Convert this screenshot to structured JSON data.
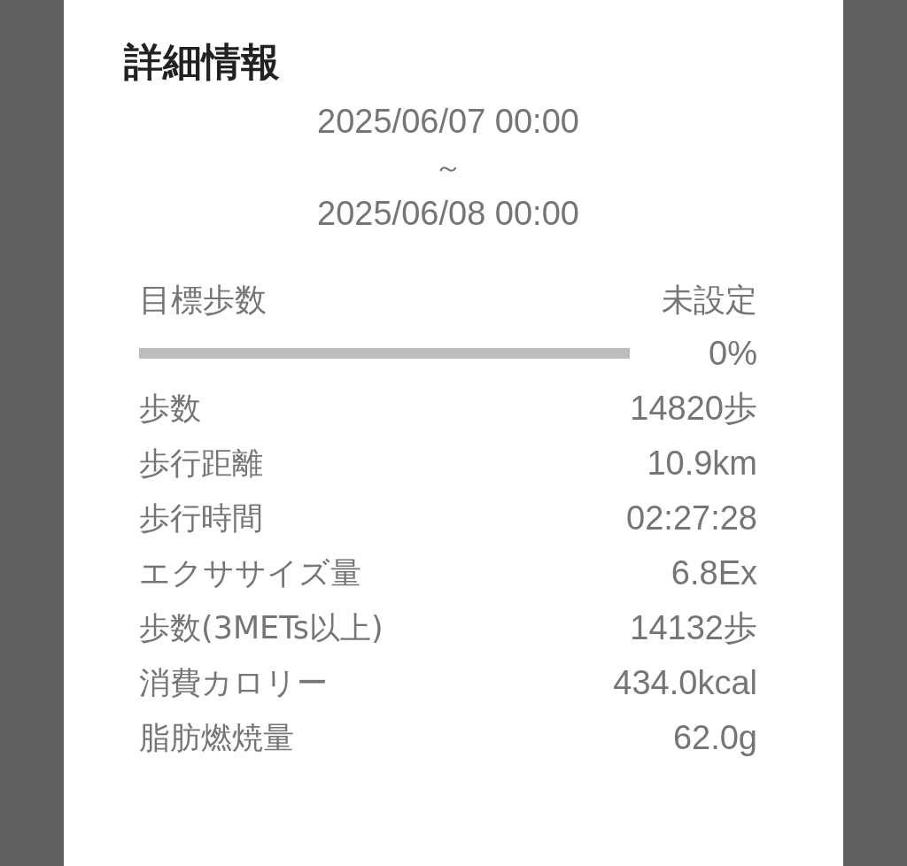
{
  "dialog": {
    "title": "詳細情報",
    "period": {
      "start": "2025/06/07 00:00",
      "separator": "～",
      "end": "2025/06/08 00:00"
    },
    "goal": {
      "label": "目標歩数",
      "value": "未設定",
      "level": 0,
      "percent": "0%"
    },
    "stats": [
      {
        "label": "歩数",
        "value": "14820歩"
      },
      {
        "label": "歩行距離",
        "value": "10.9km"
      },
      {
        "label": "歩行時間",
        "value": "02:27:28"
      },
      {
        "label": "エクササイズ量",
        "value": "6.8Ex"
      },
      {
        "label": "歩数(3METs以上)",
        "value": "14132歩"
      },
      {
        "label": "消費カロリー",
        "value": "434.0kcal"
      },
      {
        "label": "脂肪燃焼量",
        "value": "62.0g"
      }
    ]
  }
}
